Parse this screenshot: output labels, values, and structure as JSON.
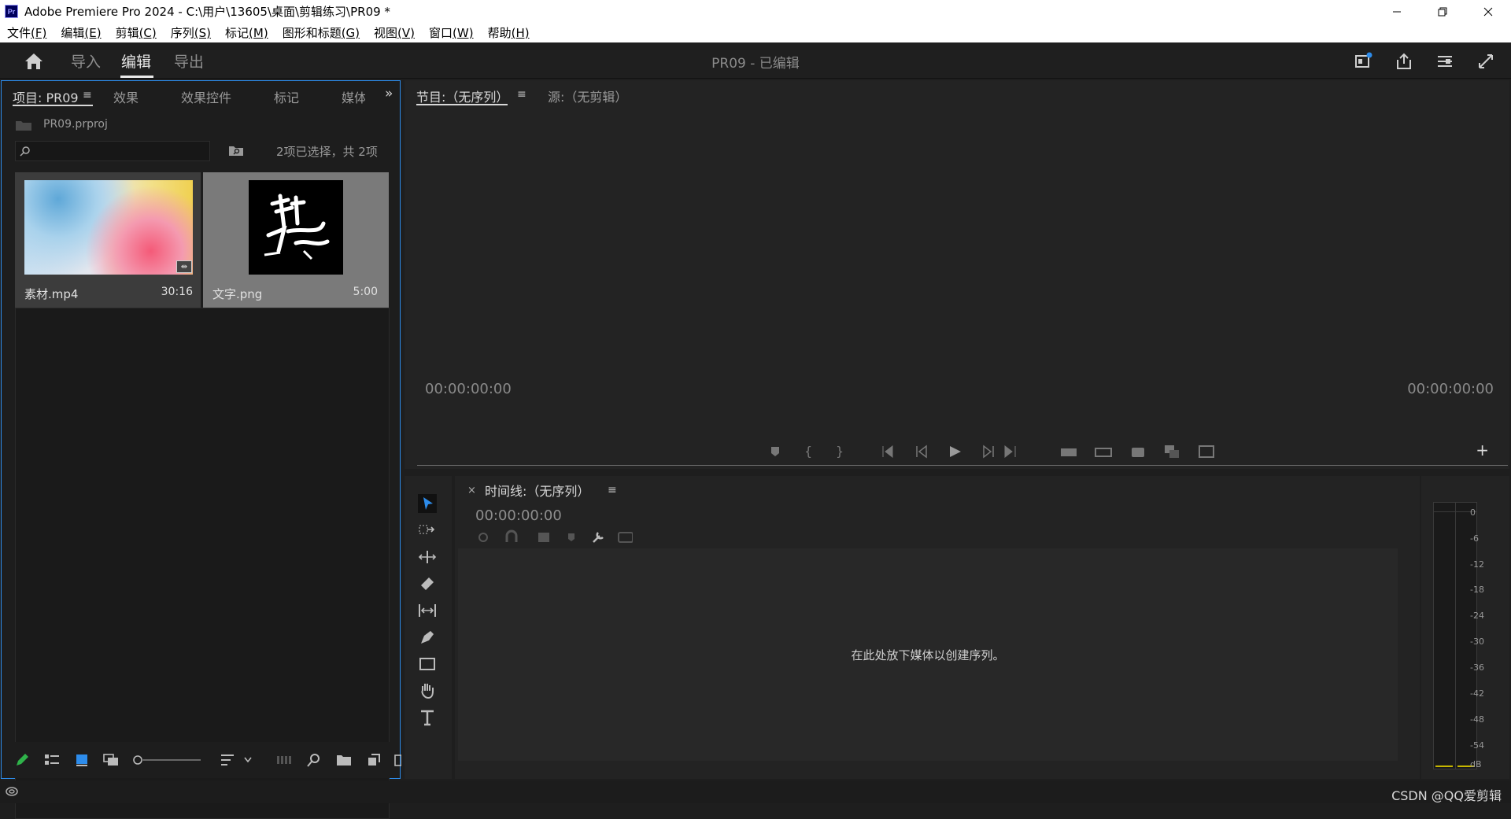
{
  "window": {
    "title": "Adobe Premiere Pro 2024 - C:\\用户\\13605\\桌面\\剪辑练习\\PR09 *",
    "logo_text": "Pr",
    "controls": [
      "minimize",
      "restore",
      "close"
    ]
  },
  "menubar": [
    {
      "label": "文件",
      "key": "(F)"
    },
    {
      "label": "编辑",
      "key": "(E)"
    },
    {
      "label": "剪辑",
      "key": "(C)"
    },
    {
      "label": "序列",
      "key": "(S)"
    },
    {
      "label": "标记",
      "key": "(M)"
    },
    {
      "label": "图形和标题",
      "key": "(G)"
    },
    {
      "label": "视图",
      "key": "(V)"
    },
    {
      "label": "窗口",
      "key": "(W)"
    },
    {
      "label": "帮助",
      "key": "(H)"
    }
  ],
  "appbar": {
    "tabs": [
      "导入",
      "编辑",
      "导出"
    ],
    "active_tab": "编辑",
    "doc_title": "PR09 - 已编辑"
  },
  "project_panel": {
    "tabs": [
      "项目: PR09",
      "效果",
      "效果控件",
      "标记",
      "媒体"
    ],
    "project_file": "PR09.prproj",
    "search_placeholder": "",
    "selection_status": "2项已选择，共 2项",
    "clips": [
      {
        "name": "素材.mp4",
        "duration": "30:16"
      },
      {
        "name": "文字.png",
        "duration": "5:00"
      }
    ]
  },
  "program_monitor": {
    "tabs": [
      "节目:（无序列）",
      "源:（无剪辑）"
    ],
    "timecode_left": "00:00:00:00",
    "timecode_right": "00:00:00:00"
  },
  "timeline": {
    "title": "时间线:（无序列）",
    "timecode": "00:00:00:00",
    "empty_message": "在此处放下媒体以创建序列。"
  },
  "audio_meter": {
    "scale": [
      "0",
      "-6",
      "-12",
      "-18",
      "-24",
      "-30",
      "-36",
      "-42",
      "-48",
      "-54",
      "dB"
    ]
  },
  "watermark": "CSDN @QQ爱剪辑",
  "colors": {
    "accent_blue": "#2d8ceb",
    "panel_bg": "#232323",
    "pencil_green": "#2fb34a",
    "meter_yellow": "#c6b600"
  }
}
